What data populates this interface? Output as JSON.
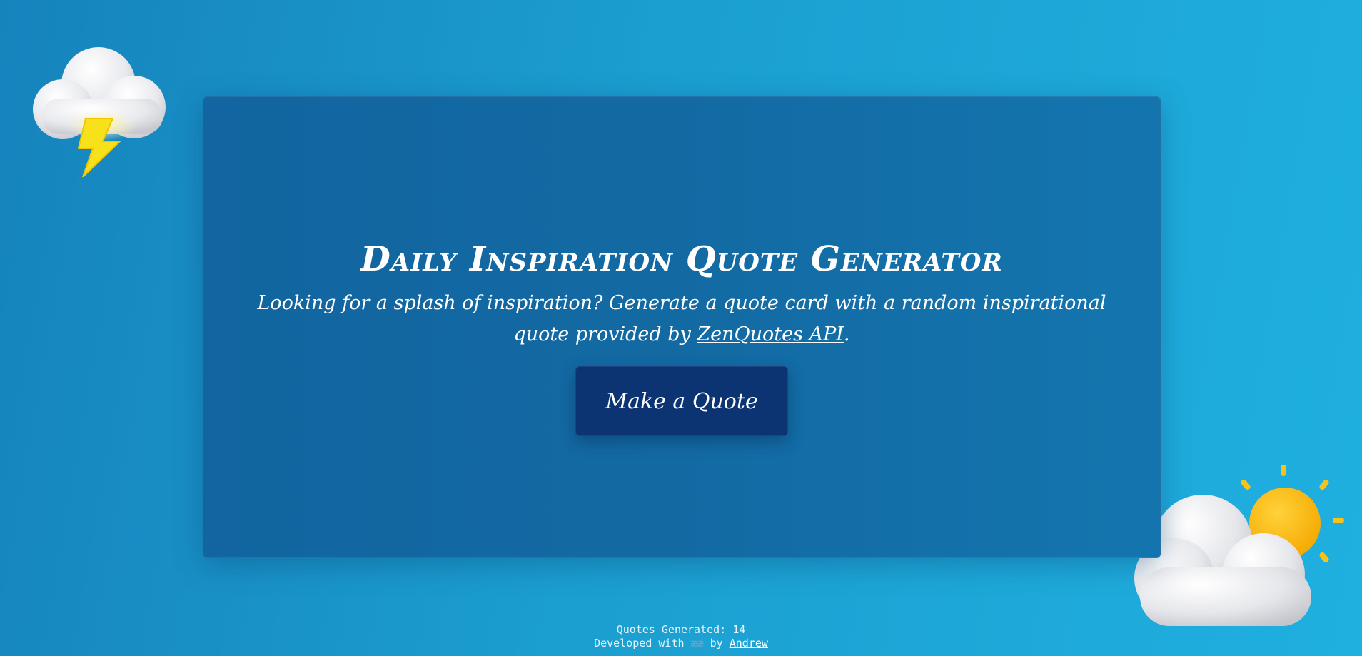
{
  "hero": {
    "title": "Daily Inspiration Quote Generator",
    "subtitle_text": "Looking for a splash of inspiration? Generate a quote card with a random inspirational quote provided by",
    "subtitle_link": "ZenQuotes API",
    "subtitle_end": ".",
    "button_label": "Make a Quote"
  },
  "footer": {
    "counter_label": "Quotes Generated:",
    "counter_value": "14",
    "developed_prefix": "Developed with",
    "developed_heart": "ææ",
    "developed_by": "by",
    "author_link": "Andrew"
  },
  "icons": {
    "top_left": "storm-cloud-icon",
    "bottom_right": "sun-behind-cloud-icon"
  },
  "colors": {
    "background": "#1b9ed0",
    "card": "#136aa3",
    "button": "#0c3473",
    "text": "#ffffff"
  }
}
